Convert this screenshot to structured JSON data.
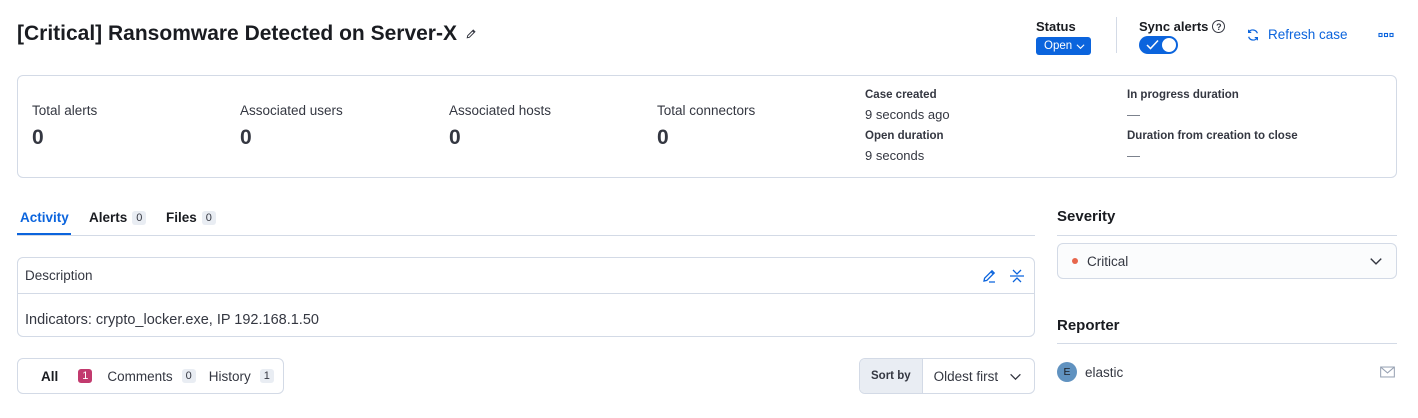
{
  "header": {
    "title": "[Critical] Ransomware Detected on Server-X",
    "status_label": "Status",
    "status_value": "Open",
    "sync_label": "Sync alerts",
    "refresh_label": "Refresh case"
  },
  "stats": {
    "items": [
      {
        "label": "Total alerts",
        "value": "0"
      },
      {
        "label": "Associated users",
        "value": "0"
      },
      {
        "label": "Associated hosts",
        "value": "0"
      },
      {
        "label": "Total connectors",
        "value": "0"
      }
    ],
    "case_created_label": "Case created",
    "case_created_value": "9 seconds ago",
    "open_duration_label": "Open duration",
    "open_duration_value": "9 seconds",
    "in_progress_label": "In progress duration",
    "in_progress_value": "—",
    "close_label": "Duration from creation to close",
    "close_value": "—"
  },
  "tabs": [
    {
      "label": "Activity"
    },
    {
      "label": "Alerts",
      "count": "0"
    },
    {
      "label": "Files",
      "count": "0"
    }
  ],
  "description": {
    "heading": "Description",
    "text": "Indicators: crypto_locker.exe, IP 192.168.1.50"
  },
  "activity_filter": {
    "all_label": "All",
    "all_count": "1",
    "comments_label": "Comments",
    "comments_count": "0",
    "history_label": "History",
    "history_count": "1"
  },
  "sort": {
    "prepend": "Sort by",
    "value": "Oldest first"
  },
  "sidebar": {
    "severity_title": "Severity",
    "severity_value": "Critical",
    "reporter_title": "Reporter",
    "reporter_initial": "E",
    "reporter_name": "elastic"
  },
  "colors": {
    "primary": "#0b64dd",
    "critical_dot": "#e7664c",
    "all_badge": "#c23a6e",
    "avatar": "#6092c0"
  }
}
